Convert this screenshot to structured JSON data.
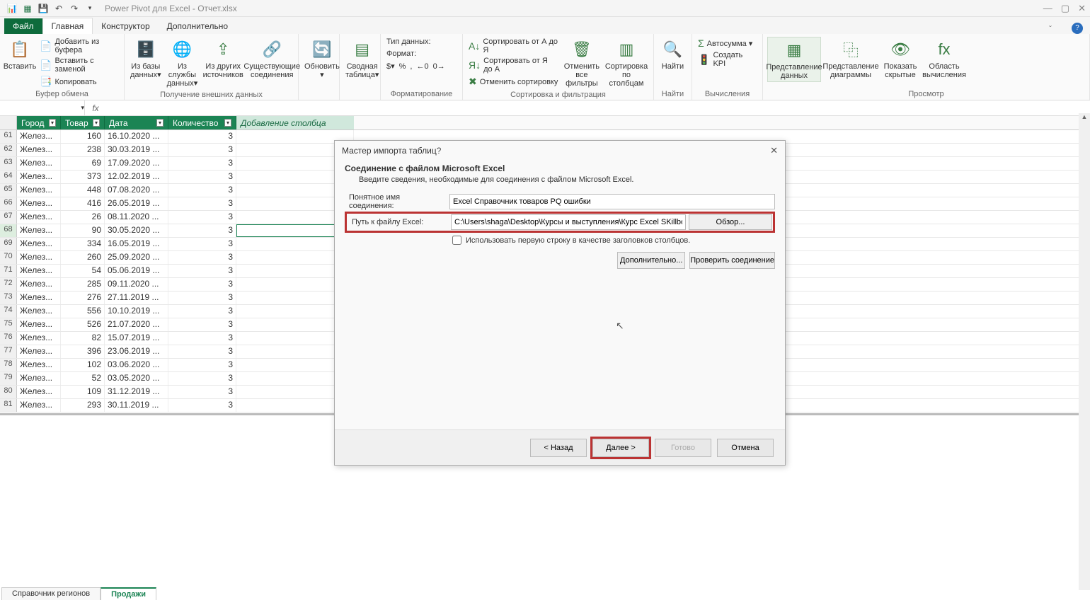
{
  "app": {
    "title": "Power Pivot для Excel - Отчет.xlsx",
    "qat": {
      "save": "💾",
      "undo": "↶",
      "redo": "↷"
    }
  },
  "tabs": {
    "file": "Файл",
    "home": "Главная",
    "design": "Конструктор",
    "advanced": "Дополнительно"
  },
  "ribbon": {
    "clipboard": {
      "paste": "Вставить",
      "add_from_buffer": "Добавить из буфера",
      "paste_replace": "Вставить с заменой",
      "copy": "Копировать",
      "group": "Буфер обмена"
    },
    "getdata": {
      "from_db": "Из базы данных▾",
      "from_service": "Из службы данных▾",
      "from_other": "Из других источников",
      "existing": "Существующие соединения",
      "group": "Получение внешних данных"
    },
    "refresh": "Обновить ▾",
    "pivot": "Сводная таблица▾",
    "format": {
      "datatype": "Тип данных:",
      "format": "Формат:",
      "group": "Форматирование"
    },
    "sort": {
      "sort_asc": "Сортировать от А до Я",
      "sort_desc": "Сортировать от Я до А",
      "clear_sort": "Отменить сортировку",
      "clear_filters": "Отменить все фильтры",
      "sort_cols": "Сортировка по столбцам",
      "group": "Сортировка и фильтрация"
    },
    "find": {
      "find": "Найти",
      "group": "Найти"
    },
    "calc": {
      "autosum": "Автосумма ▾",
      "kpi": "Создать KPI",
      "group": "Вычисления"
    },
    "view": {
      "data_view": "Представление данных",
      "diagram_view": "Представление диаграммы",
      "hidden": "Показать скрытые",
      "calc_area": "Область вычисления",
      "group": "Просмотр"
    }
  },
  "columns": {
    "city": "Город",
    "product": "Товар",
    "date": "Дата",
    "qty": "Количество",
    "add": "Добавление столбца"
  },
  "rows": [
    {
      "n": 61,
      "city": "Желез...",
      "prod": "160",
      "date": "16.10.2020 ...",
      "qty": "3"
    },
    {
      "n": 62,
      "city": "Желез...",
      "prod": "238",
      "date": "30.03.2019 ...",
      "qty": "3"
    },
    {
      "n": 63,
      "city": "Желез...",
      "prod": "69",
      "date": "17.09.2020 ...",
      "qty": "3"
    },
    {
      "n": 64,
      "city": "Желез...",
      "prod": "373",
      "date": "12.02.2019 ...",
      "qty": "3"
    },
    {
      "n": 65,
      "city": "Желез...",
      "prod": "448",
      "date": "07.08.2020 ...",
      "qty": "3"
    },
    {
      "n": 66,
      "city": "Желез...",
      "prod": "416",
      "date": "26.05.2019 ...",
      "qty": "3"
    },
    {
      "n": 67,
      "city": "Желез...",
      "prod": "26",
      "date": "08.11.2020 ...",
      "qty": "3"
    },
    {
      "n": 68,
      "city": "Желез...",
      "prod": "90",
      "date": "30.05.2020 ...",
      "qty": "3"
    },
    {
      "n": 69,
      "city": "Желез...",
      "prod": "334",
      "date": "16.05.2019 ...",
      "qty": "3"
    },
    {
      "n": 70,
      "city": "Желез...",
      "prod": "260",
      "date": "25.09.2020 ...",
      "qty": "3"
    },
    {
      "n": 71,
      "city": "Желез...",
      "prod": "54",
      "date": "05.06.2019 ...",
      "qty": "3"
    },
    {
      "n": 72,
      "city": "Желез...",
      "prod": "285",
      "date": "09.11.2020 ...",
      "qty": "3"
    },
    {
      "n": 73,
      "city": "Желез...",
      "prod": "276",
      "date": "27.11.2019 ...",
      "qty": "3"
    },
    {
      "n": 74,
      "city": "Желез...",
      "prod": "556",
      "date": "10.10.2019 ...",
      "qty": "3"
    },
    {
      "n": 75,
      "city": "Желез...",
      "prod": "526",
      "date": "21.07.2020 ...",
      "qty": "3"
    },
    {
      "n": 76,
      "city": "Желез...",
      "prod": "82",
      "date": "15.07.2019 ...",
      "qty": "3"
    },
    {
      "n": 77,
      "city": "Желез...",
      "prod": "396",
      "date": "23.06.2019 ...",
      "qty": "3"
    },
    {
      "n": 78,
      "city": "Желез...",
      "prod": "102",
      "date": "03.06.2020 ...",
      "qty": "3"
    },
    {
      "n": 79,
      "city": "Желез...",
      "prod": "52",
      "date": "03.05.2020 ...",
      "qty": "3"
    },
    {
      "n": 80,
      "city": "Желез...",
      "prod": "109",
      "date": "31.12.2019 ...",
      "qty": "3"
    },
    {
      "n": 81,
      "city": "Желез...",
      "prod": "293",
      "date": "30.11.2019 ...",
      "qty": "3"
    }
  ],
  "sheets": {
    "tab1": "Справочник регионов",
    "tab2": "Продажи"
  },
  "dialog": {
    "title": "Мастер импорта таблиц",
    "heading": "Соединение с файлом Microsoft Excel",
    "sub": "Введите сведения, необходимые для соединения с файлом Microsoft Excel.",
    "conn_name_label": "Понятное имя соединения:",
    "conn_name_value": "Excel Справочник товаров PQ ошибки",
    "path_label": "Путь к файлу Excel:",
    "path_value": "C:\\Users\\shaga\\Desktop\\Курсы и выступления\\Курс Excel SKillbox",
    "browse": "Обзор...",
    "use_first_row": "Использовать первую строку в качестве заголовков столбцов.",
    "advanced": "Дополнительно...",
    "test": "Проверить соединение",
    "back": "< Назад",
    "next": "Далее >",
    "finish": "Готово",
    "cancel": "Отмена"
  }
}
